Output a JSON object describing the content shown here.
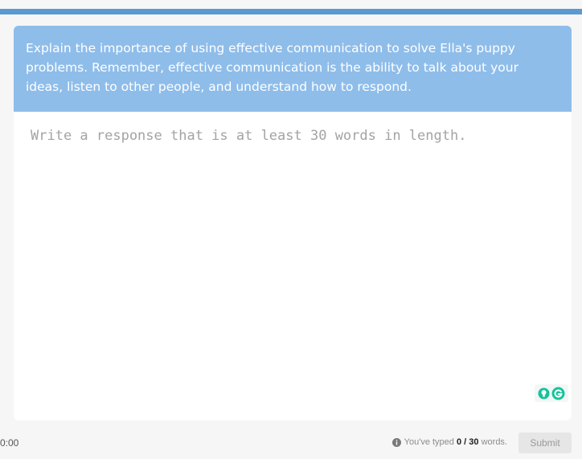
{
  "question": {
    "prompt": "Explain the importance of using effective communication to solve Ella's puppy problems. Remember, effective communication is the ability to talk about your ideas, listen to other people, and understand how to respond."
  },
  "response": {
    "placeholder": "Write a response that is at least 30 words in length.",
    "value": ""
  },
  "footer": {
    "timer": "0:00",
    "typed_prefix": "You've typed",
    "typed_count": "0",
    "separator": "/",
    "required_count": "30",
    "typed_suffix": "words.",
    "submit_label": "Submit"
  },
  "icons": {
    "info": "info-icon",
    "grammarly_bulb": "lightbulb-icon",
    "grammarly_logo": "grammarly-icon"
  },
  "colors": {
    "top_bar": "#5a9ad0",
    "prompt_bg": "#8fbdea",
    "grammarly_green": "#15c39a"
  }
}
